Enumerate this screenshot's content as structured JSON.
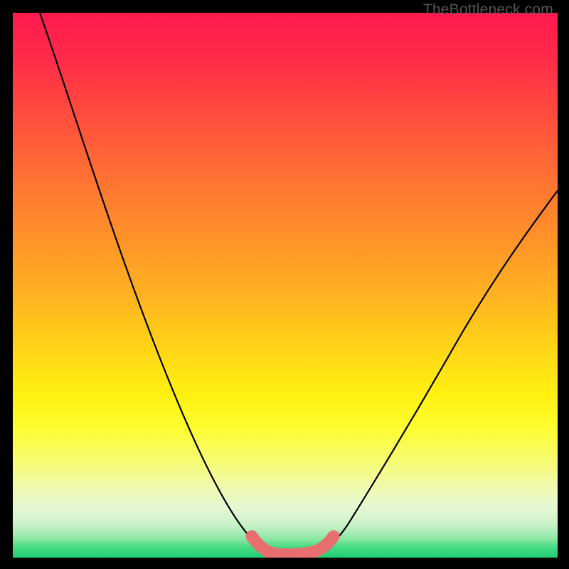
{
  "watermark": "TheBottleneck.com",
  "chart_data": {
    "type": "line",
    "title": "",
    "xlabel": "",
    "ylabel": "",
    "xlim": [
      0,
      1
    ],
    "ylim": [
      0,
      1
    ],
    "grid": false,
    "legend": false,
    "series": [
      {
        "name": "bottleneck-curve",
        "x": [
          0.0,
          0.07,
          0.14,
          0.21,
          0.28,
          0.35,
          0.4,
          0.44,
          0.47,
          0.5,
          0.53,
          0.57,
          0.6,
          0.65,
          0.72,
          0.8,
          0.88,
          0.96,
          1.0
        ],
        "y": [
          1.0,
          0.86,
          0.72,
          0.57,
          0.42,
          0.26,
          0.14,
          0.05,
          0.01,
          0.0,
          0.0,
          0.01,
          0.04,
          0.12,
          0.25,
          0.38,
          0.5,
          0.6,
          0.65
        ]
      }
    ],
    "highlight_band": {
      "name": "optimal-zone",
      "x": [
        0.455,
        0.575
      ],
      "y": 0.01
    }
  }
}
